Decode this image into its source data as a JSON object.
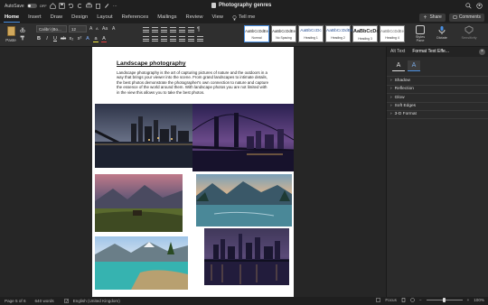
{
  "titlebar": {
    "autosave_label": "AutoSave",
    "autosave_state": "OFF",
    "doc_title": "Photography genres"
  },
  "menu": {
    "tabs": [
      "Home",
      "Insert",
      "Draw",
      "Design",
      "Layout",
      "References",
      "Mailings",
      "Review",
      "View"
    ],
    "active_tab": "Home",
    "tellme": "Tell me",
    "share": "Share",
    "comments": "Comments"
  },
  "ribbon": {
    "paste_label": "Paste",
    "font_name": "Calibri (Bo...",
    "font_size": "12",
    "styles": [
      {
        "sample": "AaBbCcDdEe",
        "name": "Normal"
      },
      {
        "sample": "AaBbCcDdEe",
        "name": "No Spacing"
      },
      {
        "sample": "AaBbCcDc",
        "name": "Heading 1"
      },
      {
        "sample": "AaBbCcDdEe",
        "name": "Heading 2"
      },
      {
        "sample": "AaBbCcDc",
        "name": "Heading 3"
      },
      {
        "sample": "AaBbCcDdEe",
        "name": "Heading 4"
      }
    ],
    "styles_pane": "Styles Pane",
    "dictate": "Dictate",
    "sensitivity": "Sensitivity"
  },
  "document": {
    "heading": "Landscape photography",
    "body": "Landscape photography is the art of capturing pictures of nature and the outdoors in a way that brings your viewer into the scene. From grand landscapes to intimate details, the best photos demonstrate the photographer's own connection to nature and capture the essence of the world around them. With landscape photos you are not limited with in the view this allows you to take the best photos."
  },
  "pane": {
    "tabs": [
      "Alt Text",
      "Format Text Effe..."
    ],
    "active_tab": "Format Text Effe...",
    "items": [
      "Shadow",
      "Reflection",
      "Glow",
      "Soft Edges",
      "3-D Format"
    ]
  },
  "status": {
    "page": "Page 5 of 6",
    "words": "640 words",
    "language": "English (United Kingdom)",
    "focus": "Focus",
    "zoom": "100%",
    "zoom_level": 0.5
  },
  "colors": {
    "accent": "#4a90e2"
  }
}
